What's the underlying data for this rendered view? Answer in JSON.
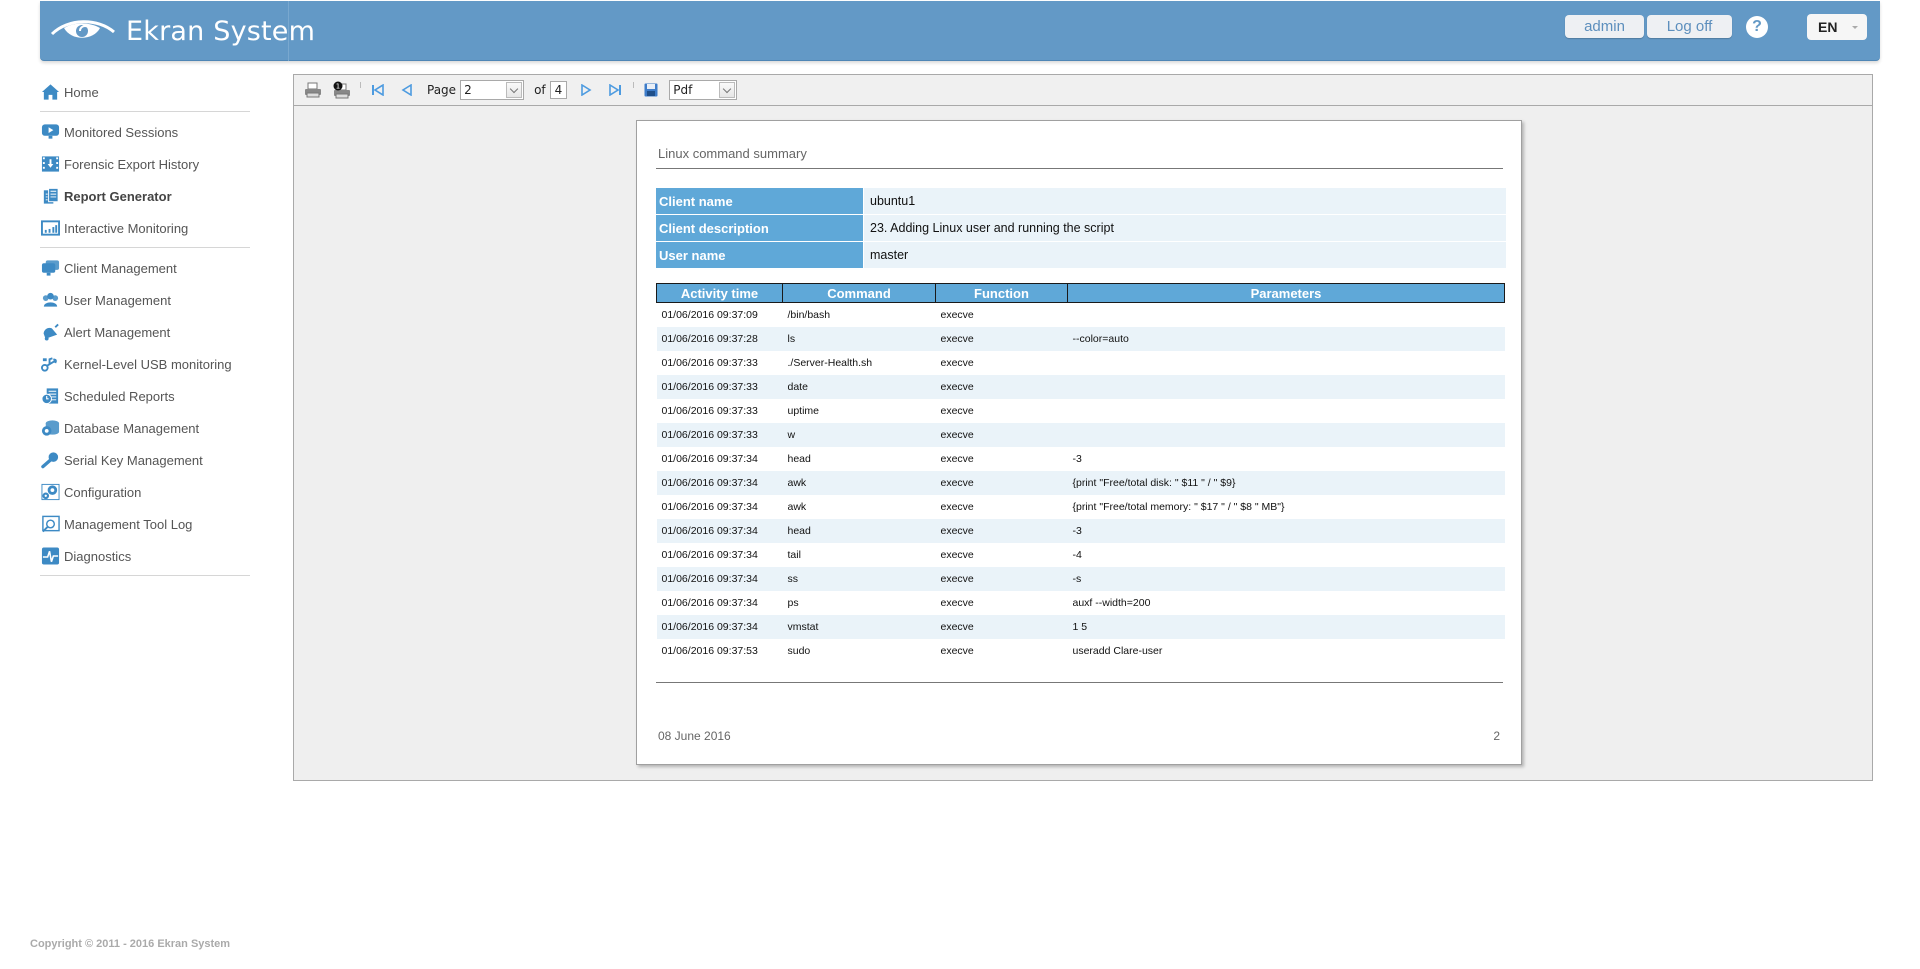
{
  "header": {
    "app_name": "Ekran System",
    "user_button": "admin",
    "logoff_button": "Log off",
    "help_label": "?",
    "language": "EN"
  },
  "sidebar": {
    "items": [
      {
        "label": "Home",
        "icon": "home-icon",
        "active": false
      },
      {
        "label": "Monitored Sessions",
        "icon": "monitor-play-icon",
        "active": false
      },
      {
        "label": "Forensic Export History",
        "icon": "film-download-icon",
        "active": false
      },
      {
        "label": "Report Generator",
        "icon": "report-icon",
        "active": true
      },
      {
        "label": "Interactive Monitoring",
        "icon": "chart-window-icon",
        "active": false
      },
      {
        "label": "Client Management",
        "icon": "computers-icon",
        "active": false
      },
      {
        "label": "User Management",
        "icon": "users-icon",
        "active": false
      },
      {
        "label": "Alert Management",
        "icon": "bell-icon",
        "active": false
      },
      {
        "label": "Kernel-Level USB monitoring",
        "icon": "usb-icon",
        "active": false
      },
      {
        "label": "Scheduled Reports",
        "icon": "scheduled-report-icon",
        "active": false
      },
      {
        "label": "Database Management",
        "icon": "database-gear-icon",
        "active": false
      },
      {
        "label": "Serial Key Management",
        "icon": "key-icon",
        "active": false
      },
      {
        "label": "Configuration",
        "icon": "gears-icon",
        "active": false
      },
      {
        "label": "Management Tool Log",
        "icon": "log-icon",
        "active": false
      },
      {
        "label": "Diagnostics",
        "icon": "pulse-icon",
        "active": false
      }
    ]
  },
  "toolbar": {
    "page_label": "Page",
    "current_page": "2",
    "of_label": "of",
    "total_pages": "4",
    "export_format": "Pdf"
  },
  "report": {
    "title": "Linux command summary",
    "info": [
      {
        "label": "Client name",
        "value": "ubuntu1"
      },
      {
        "label": "Client description",
        "value": "23. Adding Linux user and running the script"
      },
      {
        "label": "User name",
        "value": "master"
      }
    ],
    "columns": [
      "Activity time",
      "Command",
      "Function",
      "Parameters"
    ],
    "rows": [
      [
        "01/06/2016 09:37:09",
        "/bin/bash",
        "execve",
        ""
      ],
      [
        "01/06/2016 09:37:28",
        "ls",
        "execve",
        "--color=auto"
      ],
      [
        "01/06/2016 09:37:33",
        "./Server-Health.sh",
        "execve",
        ""
      ],
      [
        "01/06/2016 09:37:33",
        "date",
        "execve",
        ""
      ],
      [
        "01/06/2016 09:37:33",
        "uptime",
        "execve",
        ""
      ],
      [
        "01/06/2016 09:37:33",
        "w",
        "execve",
        ""
      ],
      [
        "01/06/2016 09:37:34",
        "head",
        "execve",
        "-3"
      ],
      [
        "01/06/2016 09:37:34",
        "awk",
        "execve",
        "{print \"Free/total disk: \" $11 \" / \" $9}"
      ],
      [
        "01/06/2016 09:37:34",
        "awk",
        "execve",
        "{print \"Free/total memory: \" $17 \" / \" $8 \" MB\"}"
      ],
      [
        "01/06/2016 09:37:34",
        "head",
        "execve",
        "-3"
      ],
      [
        "01/06/2016 09:37:34",
        "tail",
        "execve",
        "-4"
      ],
      [
        "01/06/2016 09:37:34",
        "ss",
        "execve",
        "-s"
      ],
      [
        "01/06/2016 09:37:34",
        "ps",
        "execve",
        "auxf --width=200"
      ],
      [
        "01/06/2016 09:37:34",
        "vmstat",
        "execve",
        "1 5"
      ],
      [
        "01/06/2016 09:37:53",
        "sudo",
        "execve",
        "useradd Clare-user"
      ]
    ],
    "footer_date": "08 June 2016",
    "footer_page": "2"
  },
  "copyright": "Copyright © 2011 - 2016 Ekran System",
  "colors": {
    "header_bg": "#6399c6",
    "accent": "#5fa8d8",
    "row_alt": "#eaf3f9",
    "icon": "#3d8ac4"
  }
}
